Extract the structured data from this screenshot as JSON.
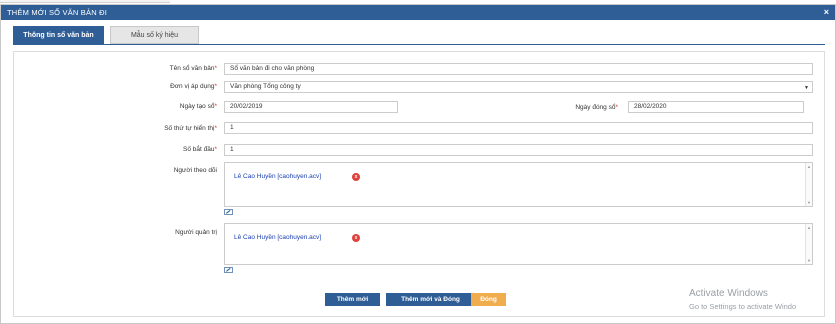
{
  "dialog": {
    "title": "THÊM MỚI SỔ VĂN BẢN ĐI",
    "close": "×"
  },
  "tabs": [
    {
      "label": "Thông tin sổ văn bản"
    },
    {
      "label": "Mẫu số ký hiệu"
    }
  ],
  "form": {
    "ten_so": {
      "label": "Tên sổ văn bản",
      "value": "Sổ văn bản đi cho văn phòng"
    },
    "don_vi": {
      "label": "Đơn vị áp dụng",
      "value": "Văn phòng Tổng công ty"
    },
    "ngay_tao": {
      "label": "Ngày tạo sổ",
      "value": "20/02/2019"
    },
    "ngay_dong": {
      "label": "Ngày đóng sổ",
      "value": "28/02/2020"
    },
    "so_thu_tu": {
      "label": "Số thứ tự hiển thị",
      "value": "1"
    },
    "so_bat_dau": {
      "label": "Số bắt đầu",
      "value": "1"
    },
    "nguoi_theo_doi": {
      "label": "Người theo dõi",
      "user": "Lê Cao Huyền [caohuyen.acv]"
    },
    "nguoi_quan_tri": {
      "label": "Người quản trị",
      "user": "Lê Cao Huyền [caohuyen.acv]"
    },
    "required_mark": "*",
    "remove_glyph": "x"
  },
  "buttons": {
    "add": "Thêm mới",
    "add_close": "Thêm mới và Đóng",
    "close": "Đóng"
  },
  "watermark": {
    "line1": "Activate Windows",
    "line2": "Go to Settings to activate Windo"
  },
  "colors": {
    "header": "#2f5d95",
    "warning_button": "#f0ad4e",
    "remove": "#e0413a"
  }
}
